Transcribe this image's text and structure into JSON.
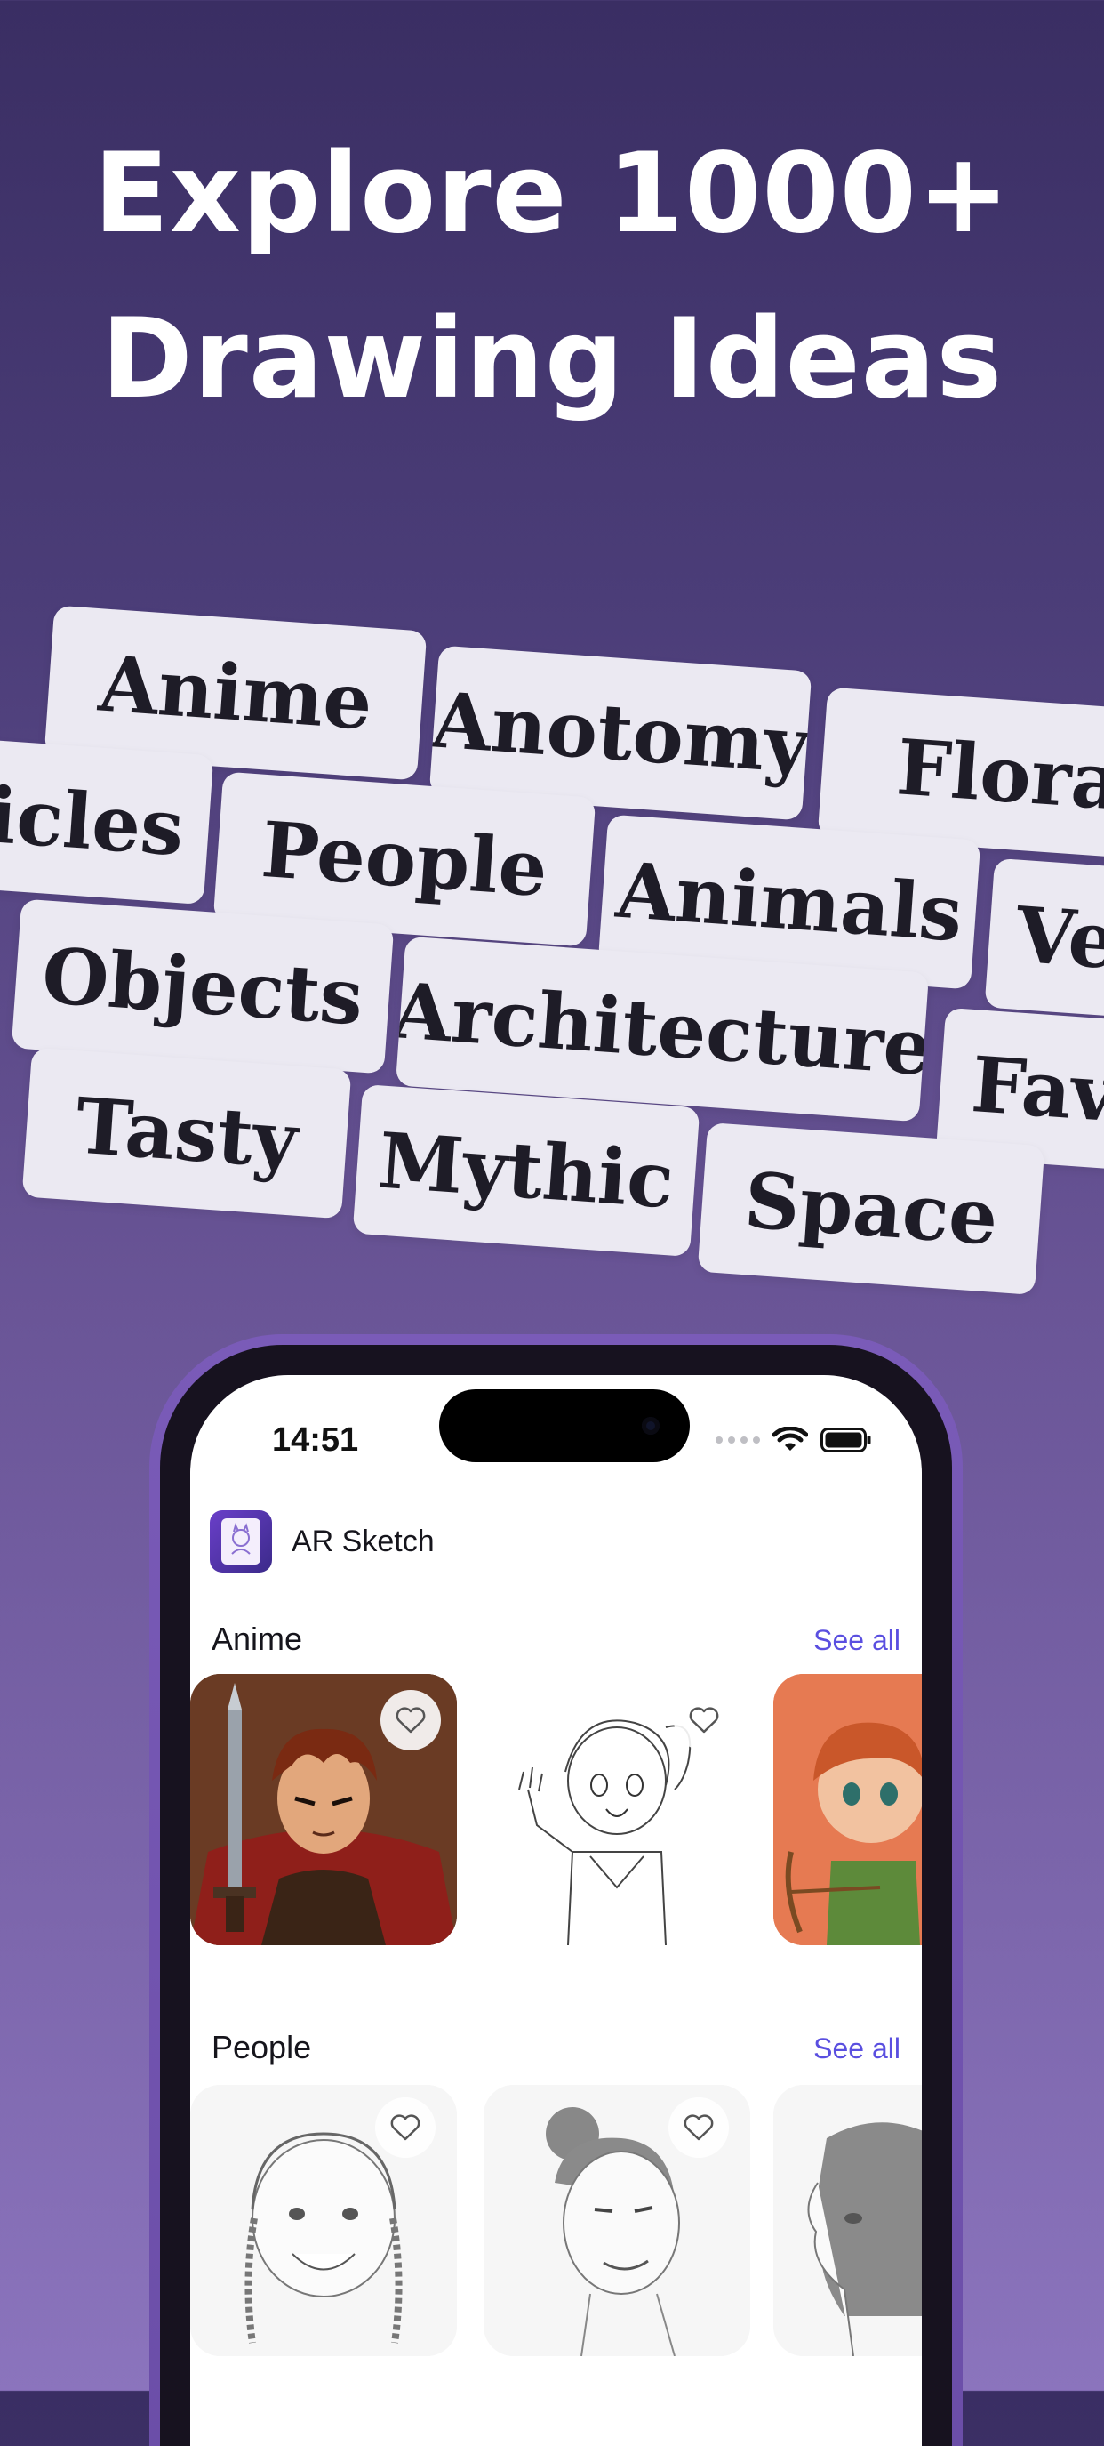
{
  "headline": {
    "line1": "Explore 1000+",
    "line2": "Drawing Ideas"
  },
  "category_chips": [
    "Anime",
    "Anotomy",
    "Flora",
    "hicles",
    "People",
    "Animals",
    "Ve",
    "Objects",
    "Architecture",
    "Fav",
    "Tasty",
    "Mythic",
    "Space"
  ],
  "phone": {
    "status_bar": {
      "time": "14:51"
    },
    "app": {
      "title": "AR Sketch"
    },
    "sections": [
      {
        "title": "Anime",
        "see_all": "See all",
        "items": [
          "warrior-with-sword",
          "waving-girl-sketch",
          "archer-girl"
        ]
      },
      {
        "title": "People",
        "see_all": "See all",
        "items": [
          "girl-with-braids",
          "woman-with-bun",
          "woman-profile"
        ]
      }
    ]
  },
  "colors": {
    "background_top": "#3a2e63",
    "background_bottom": "#8b74bd",
    "chip_bg": "#ebe9f2",
    "accent_link": "#5a4fe0",
    "phone_frame": "#7a5bb8"
  }
}
